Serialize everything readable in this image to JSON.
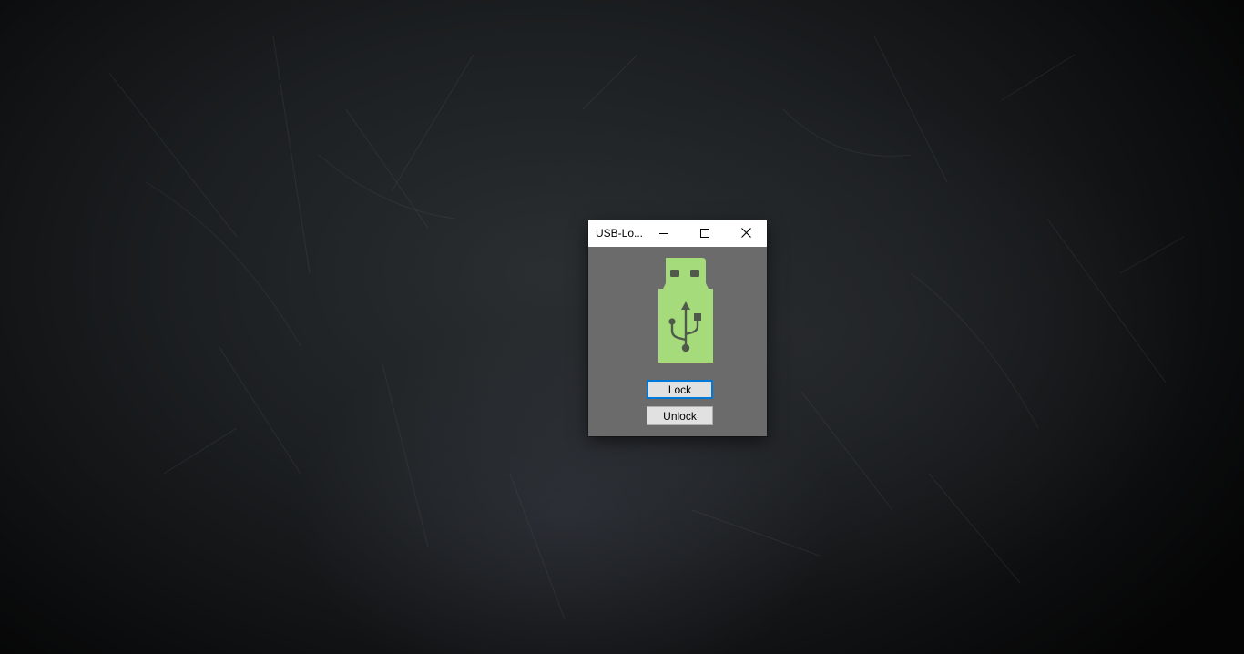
{
  "window": {
    "title": "USB-Lo...",
    "minimize_icon": "minimize-icon",
    "maximize_icon": "maximize-icon",
    "close_icon": "close-icon"
  },
  "content": {
    "logo_icon": "usb-drive-icon",
    "lock_label": "Lock",
    "unlock_label": "Unlock"
  },
  "colors": {
    "client_background": "#6b6b6b",
    "usb_green": "#a6db7c",
    "usb_symbol": "#4f5a4b",
    "focus_border": "#0078d7",
    "button_face": "#e1e1e1"
  }
}
